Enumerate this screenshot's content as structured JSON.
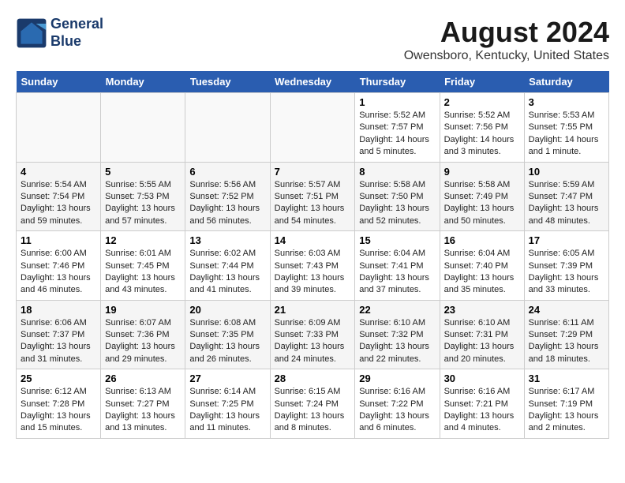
{
  "header": {
    "logo_line1": "General",
    "logo_line2": "Blue",
    "title": "August 2024",
    "subtitle": "Owensboro, Kentucky, United States"
  },
  "days_of_week": [
    "Sunday",
    "Monday",
    "Tuesday",
    "Wednesday",
    "Thursday",
    "Friday",
    "Saturday"
  ],
  "weeks": [
    [
      {
        "day": "",
        "info": ""
      },
      {
        "day": "",
        "info": ""
      },
      {
        "day": "",
        "info": ""
      },
      {
        "day": "",
        "info": ""
      },
      {
        "day": "1",
        "info": "Sunrise: 5:52 AM\nSunset: 7:57 PM\nDaylight: 14 hours\nand 5 minutes."
      },
      {
        "day": "2",
        "info": "Sunrise: 5:52 AM\nSunset: 7:56 PM\nDaylight: 14 hours\nand 3 minutes."
      },
      {
        "day": "3",
        "info": "Sunrise: 5:53 AM\nSunset: 7:55 PM\nDaylight: 14 hours\nand 1 minute."
      }
    ],
    [
      {
        "day": "4",
        "info": "Sunrise: 5:54 AM\nSunset: 7:54 PM\nDaylight: 13 hours\nand 59 minutes."
      },
      {
        "day": "5",
        "info": "Sunrise: 5:55 AM\nSunset: 7:53 PM\nDaylight: 13 hours\nand 57 minutes."
      },
      {
        "day": "6",
        "info": "Sunrise: 5:56 AM\nSunset: 7:52 PM\nDaylight: 13 hours\nand 56 minutes."
      },
      {
        "day": "7",
        "info": "Sunrise: 5:57 AM\nSunset: 7:51 PM\nDaylight: 13 hours\nand 54 minutes."
      },
      {
        "day": "8",
        "info": "Sunrise: 5:58 AM\nSunset: 7:50 PM\nDaylight: 13 hours\nand 52 minutes."
      },
      {
        "day": "9",
        "info": "Sunrise: 5:58 AM\nSunset: 7:49 PM\nDaylight: 13 hours\nand 50 minutes."
      },
      {
        "day": "10",
        "info": "Sunrise: 5:59 AM\nSunset: 7:47 PM\nDaylight: 13 hours\nand 48 minutes."
      }
    ],
    [
      {
        "day": "11",
        "info": "Sunrise: 6:00 AM\nSunset: 7:46 PM\nDaylight: 13 hours\nand 46 minutes."
      },
      {
        "day": "12",
        "info": "Sunrise: 6:01 AM\nSunset: 7:45 PM\nDaylight: 13 hours\nand 43 minutes."
      },
      {
        "day": "13",
        "info": "Sunrise: 6:02 AM\nSunset: 7:44 PM\nDaylight: 13 hours\nand 41 minutes."
      },
      {
        "day": "14",
        "info": "Sunrise: 6:03 AM\nSunset: 7:43 PM\nDaylight: 13 hours\nand 39 minutes."
      },
      {
        "day": "15",
        "info": "Sunrise: 6:04 AM\nSunset: 7:41 PM\nDaylight: 13 hours\nand 37 minutes."
      },
      {
        "day": "16",
        "info": "Sunrise: 6:04 AM\nSunset: 7:40 PM\nDaylight: 13 hours\nand 35 minutes."
      },
      {
        "day": "17",
        "info": "Sunrise: 6:05 AM\nSunset: 7:39 PM\nDaylight: 13 hours\nand 33 minutes."
      }
    ],
    [
      {
        "day": "18",
        "info": "Sunrise: 6:06 AM\nSunset: 7:37 PM\nDaylight: 13 hours\nand 31 minutes."
      },
      {
        "day": "19",
        "info": "Sunrise: 6:07 AM\nSunset: 7:36 PM\nDaylight: 13 hours\nand 29 minutes."
      },
      {
        "day": "20",
        "info": "Sunrise: 6:08 AM\nSunset: 7:35 PM\nDaylight: 13 hours\nand 26 minutes."
      },
      {
        "day": "21",
        "info": "Sunrise: 6:09 AM\nSunset: 7:33 PM\nDaylight: 13 hours\nand 24 minutes."
      },
      {
        "day": "22",
        "info": "Sunrise: 6:10 AM\nSunset: 7:32 PM\nDaylight: 13 hours\nand 22 minutes."
      },
      {
        "day": "23",
        "info": "Sunrise: 6:10 AM\nSunset: 7:31 PM\nDaylight: 13 hours\nand 20 minutes."
      },
      {
        "day": "24",
        "info": "Sunrise: 6:11 AM\nSunset: 7:29 PM\nDaylight: 13 hours\nand 18 minutes."
      }
    ],
    [
      {
        "day": "25",
        "info": "Sunrise: 6:12 AM\nSunset: 7:28 PM\nDaylight: 13 hours\nand 15 minutes."
      },
      {
        "day": "26",
        "info": "Sunrise: 6:13 AM\nSunset: 7:27 PM\nDaylight: 13 hours\nand 13 minutes."
      },
      {
        "day": "27",
        "info": "Sunrise: 6:14 AM\nSunset: 7:25 PM\nDaylight: 13 hours\nand 11 minutes."
      },
      {
        "day": "28",
        "info": "Sunrise: 6:15 AM\nSunset: 7:24 PM\nDaylight: 13 hours\nand 8 minutes."
      },
      {
        "day": "29",
        "info": "Sunrise: 6:16 AM\nSunset: 7:22 PM\nDaylight: 13 hours\nand 6 minutes."
      },
      {
        "day": "30",
        "info": "Sunrise: 6:16 AM\nSunset: 7:21 PM\nDaylight: 13 hours\nand 4 minutes."
      },
      {
        "day": "31",
        "info": "Sunrise: 6:17 AM\nSunset: 7:19 PM\nDaylight: 13 hours\nand 2 minutes."
      }
    ]
  ]
}
